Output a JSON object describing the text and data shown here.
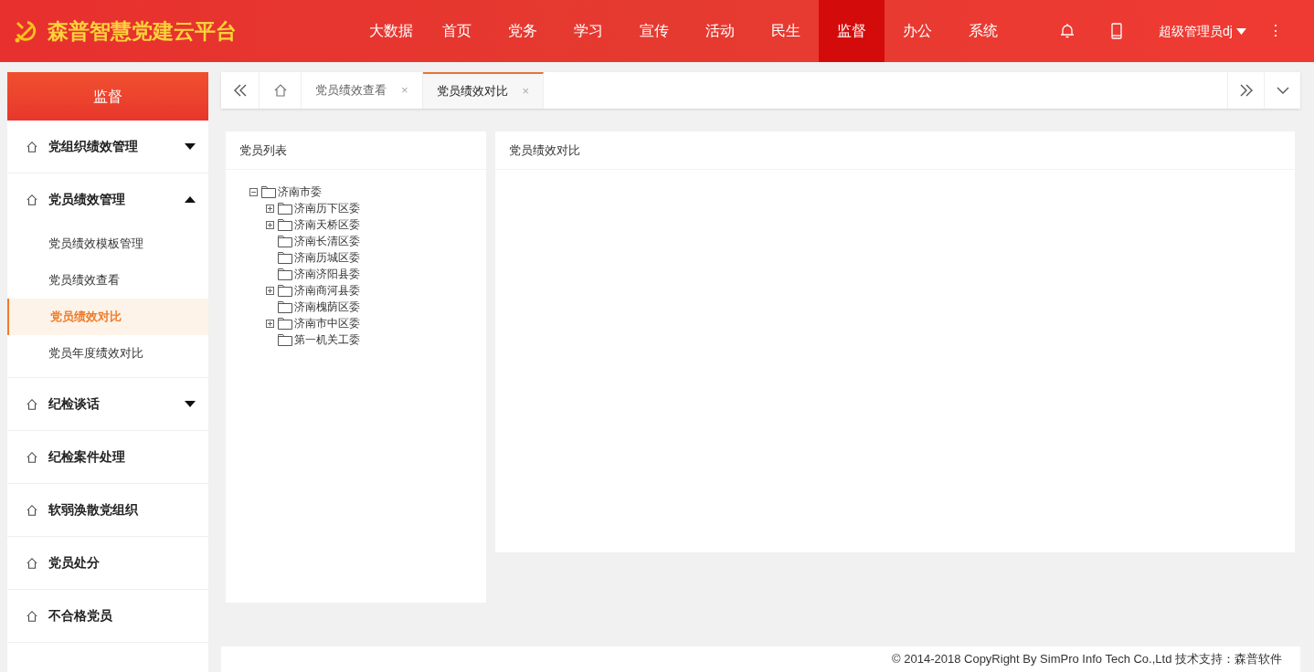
{
  "header": {
    "title": "森普智慧党建云平台",
    "nav": [
      {
        "label": "大数据",
        "selected": false
      },
      {
        "label": "首页",
        "selected": false
      },
      {
        "label": "党务",
        "selected": false
      },
      {
        "label": "学习",
        "selected": false
      },
      {
        "label": "宣传",
        "selected": false
      },
      {
        "label": "活动",
        "selected": false
      },
      {
        "label": "民生",
        "selected": false
      },
      {
        "label": "监督",
        "selected": true
      },
      {
        "label": "办公",
        "selected": false
      },
      {
        "label": "系统",
        "selected": false
      }
    ],
    "user": "超级管理员dj",
    "more": "⋮"
  },
  "sidebar": {
    "title": "监督",
    "items": [
      {
        "label": "党组织绩效管理",
        "expanded": false
      },
      {
        "label": "党员绩效管理",
        "expanded": true,
        "children": [
          {
            "label": "党员绩效模板管理",
            "selected": false
          },
          {
            "label": "党员绩效查看",
            "selected": false
          },
          {
            "label": "党员绩效对比",
            "selected": true
          },
          {
            "label": "党员年度绩效对比",
            "selected": false
          }
        ]
      },
      {
        "label": "纪检谈话",
        "expanded": false
      },
      {
        "label": "纪检案件处理"
      },
      {
        "label": "软弱涣散党组织"
      },
      {
        "label": "党员处分"
      },
      {
        "label": "不合格党员"
      }
    ]
  },
  "tabs": [
    {
      "label": "党员绩效查看",
      "selected": false,
      "close": "×"
    },
    {
      "label": "党员绩效对比",
      "selected": true,
      "close": "×"
    }
  ],
  "member_panel": {
    "title": "党员列表",
    "tree": [
      {
        "label": "济南市委",
        "expanded": true,
        "children": [
          {
            "label": "济南历下区委",
            "expanded": false
          },
          {
            "label": "济南天桥区委",
            "expanded": false
          },
          {
            "label": "济南长清区委"
          },
          {
            "label": "济南历城区委"
          },
          {
            "label": "济南济阳县委"
          },
          {
            "label": "济南商河县委",
            "expanded": false
          },
          {
            "label": "济南槐荫区委"
          },
          {
            "label": "济南市中区委",
            "expanded": false
          },
          {
            "label": "第一机关工委"
          }
        ]
      }
    ]
  },
  "compare_panel": {
    "title": "党员绩效对比"
  },
  "footer": "© 2014-2018 CopyRight By SimPro Info Tech Co.,Ltd 技术支持：森普软件"
}
